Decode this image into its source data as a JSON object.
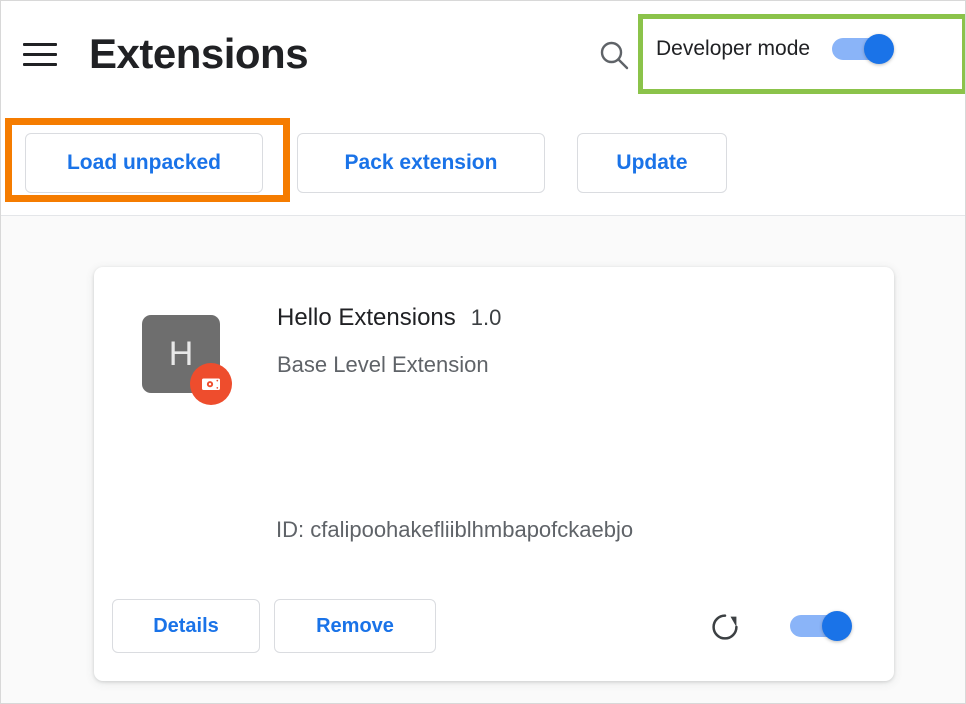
{
  "header": {
    "menu_icon": "hamburger-menu-icon",
    "title": "Extensions",
    "search_icon": "search-icon",
    "developer_mode_label": "Developer mode",
    "developer_mode_on": true
  },
  "toolbar": {
    "load_unpacked_label": "Load unpacked",
    "pack_extension_label": "Pack extension",
    "update_label": "Update"
  },
  "annotations": [
    {
      "name": "developer-mode-highlight",
      "color": "#8bc34a"
    },
    {
      "name": "load-unpacked-highlight",
      "color": "#f57c00"
    }
  ],
  "extension": {
    "icon_letter": "H",
    "unpacked_badge_icon": "unpacked-package-icon",
    "name": "Hello Extensions",
    "version": "1.0",
    "description": "Base Level Extension",
    "id_text": "ID: cfalipoohakefliiblhmbapofckaebjo",
    "details_label": "Details",
    "remove_label": "Remove",
    "reload_icon": "reload-icon",
    "enabled": true
  },
  "colors": {
    "accent_blue": "#1a73e8",
    "toggle_track": "#8ab4f8",
    "badge_orange": "#ee4d2d",
    "annotation_green": "#8bc34a",
    "annotation_orange": "#f57c00"
  }
}
